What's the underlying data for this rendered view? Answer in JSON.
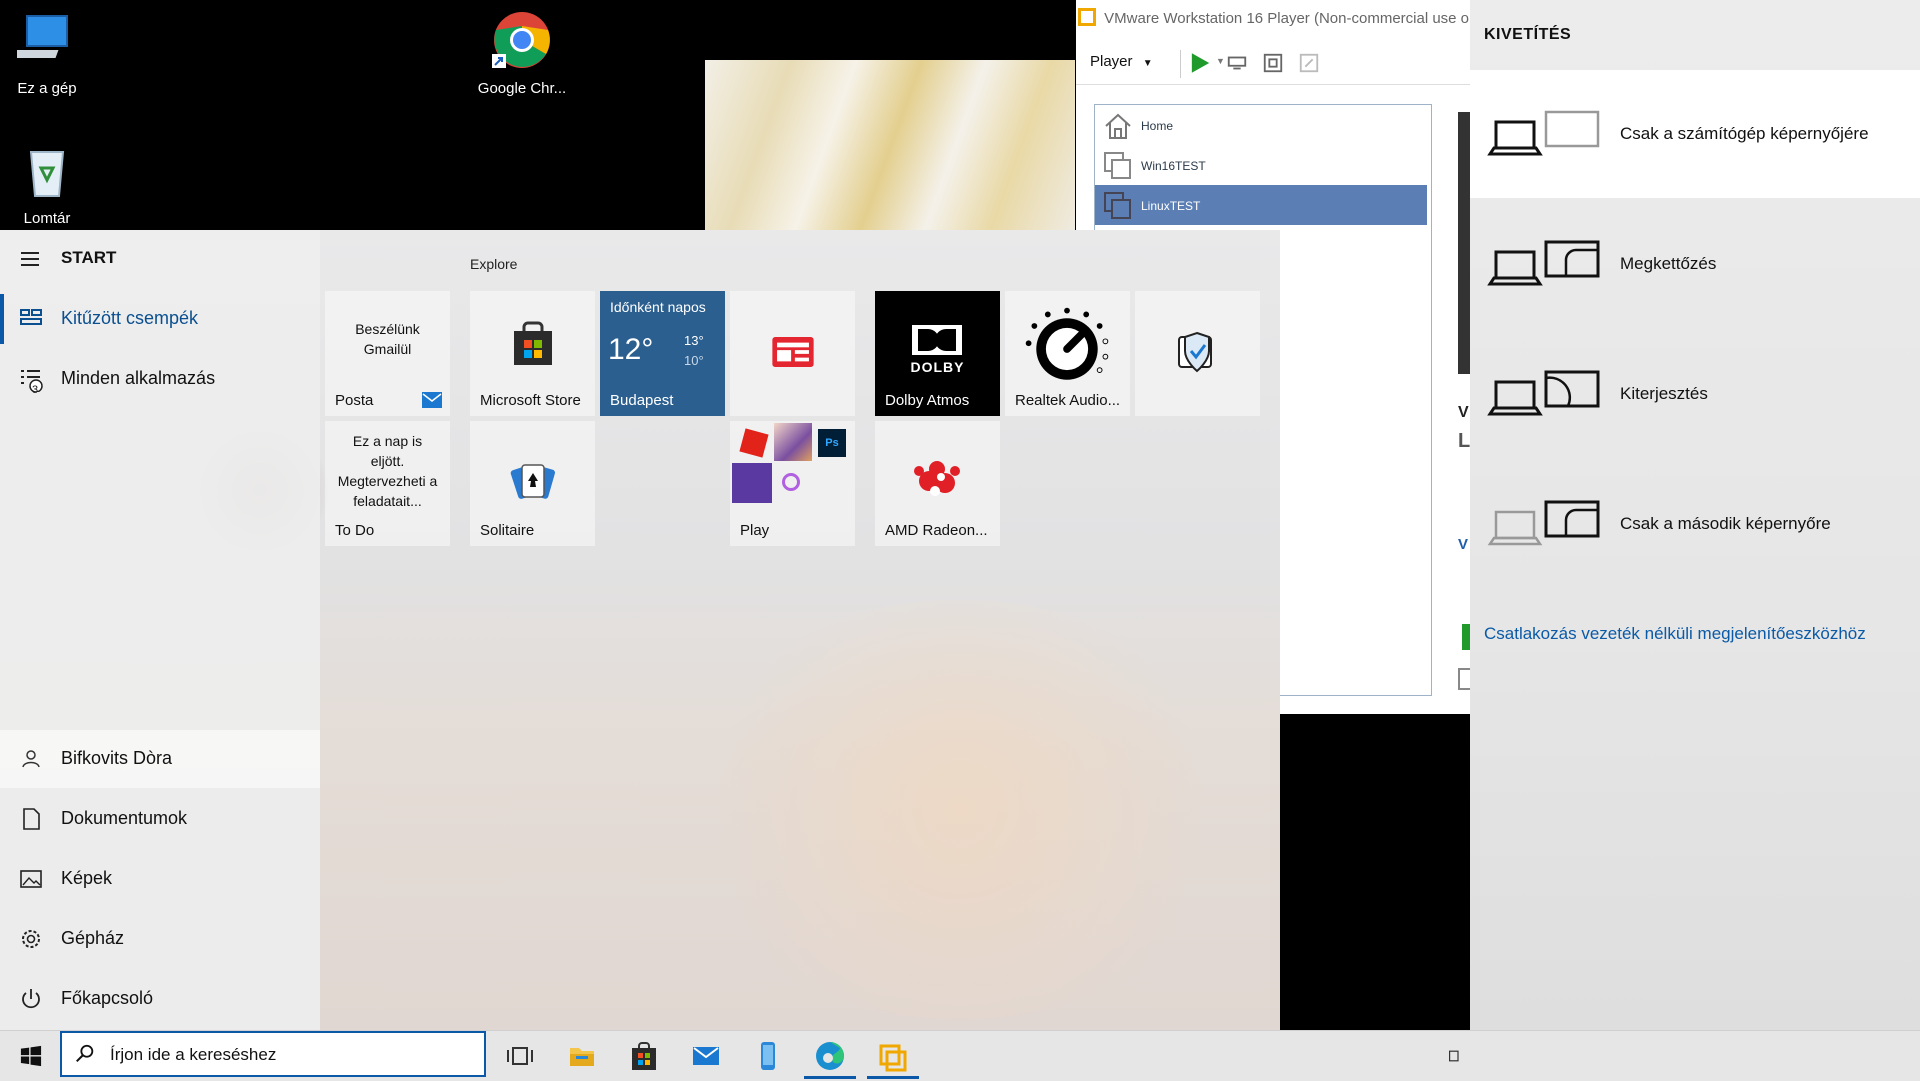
{
  "desktop": {
    "icons": [
      {
        "label": "Ez a gép"
      },
      {
        "label": "Google Chr..."
      },
      {
        "label": "Lomtár"
      }
    ]
  },
  "vmware": {
    "title": "VMware Workstation 16 Player (Non-commercial use o",
    "player_label": "Player",
    "library": [
      {
        "label": "Home"
      },
      {
        "label": "Win16TEST"
      },
      {
        "label": "LinuxTEST"
      }
    ],
    "peek_text": [
      "V",
      "L",
      "V"
    ]
  },
  "start": {
    "header": "START",
    "pinned_label": "Kitűzött csempék",
    "all_apps_label": "Minden alkalmazás",
    "all_apps_badge": "3",
    "user": "Bifkovits Dòra",
    "documents": "Dokumentumok",
    "pictures": "Képek",
    "settings": "Gépház",
    "power": "Főkapcsoló",
    "group_title": "Explore",
    "tiles": {
      "mail_text": "Beszélünk Gmailül",
      "mail_name": "Posta",
      "store_name": "Microsoft Store",
      "weather_cond": "Időnként napos",
      "weather_temp": "12°",
      "weather_hi": "13°",
      "weather_lo": "10°",
      "weather_city": "Budapest",
      "dolby_logo": "DOLBY",
      "dolby_name": "Dolby Atmos",
      "realtek_name": "Realtek Audio...",
      "todo_text": "Ez a nap is eljött. Megtervezheti a feladatait...",
      "todo_name": "To Do",
      "solitaire_name": "Solitaire",
      "play_name": "Play",
      "ps_label": "Ps",
      "amd_name": "AMD Radeon..."
    }
  },
  "projection": {
    "title": "KIVETÍTÉS",
    "options": [
      {
        "label": "Csak a számítógép képernyőjére",
        "selected": true
      },
      {
        "label": "Megkettőzés",
        "selected": false
      },
      {
        "label": "Kiterjesztés",
        "selected": false
      },
      {
        "label": "Csak a második képernyőre",
        "selected": false
      }
    ],
    "wireless_link": "Csatlakozás vezeték nélküli megjelenítőeszközhöz"
  },
  "taskbar": {
    "search_placeholder": "Írjon ide a kereséshez"
  },
  "colors": {
    "accent": "#0b58a8",
    "weather_tile": "#2b5f8f",
    "dolby_tile": "#000000",
    "vm_selected": "#5b7fb5",
    "amd_red": "#e01f26"
  }
}
